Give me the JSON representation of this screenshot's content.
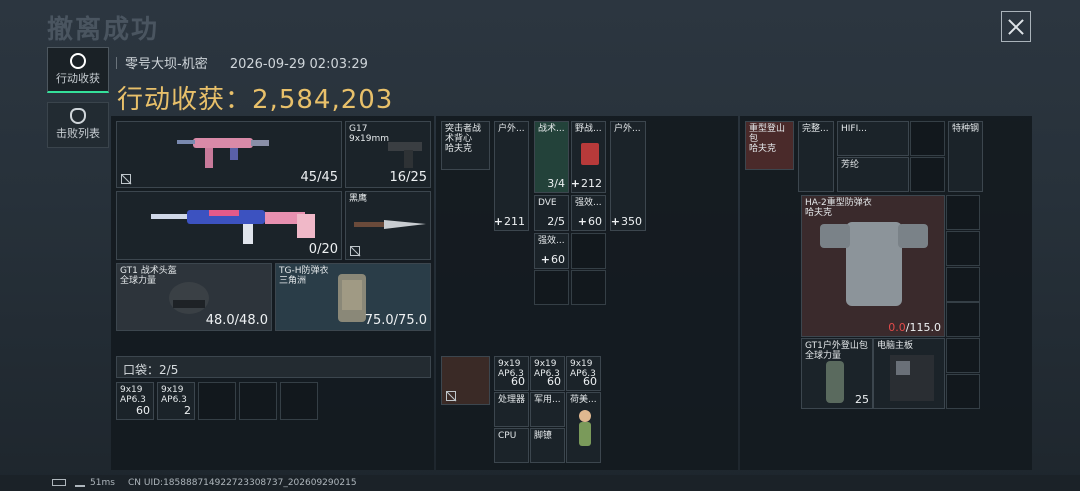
{
  "header": {
    "title": "撤离成功",
    "map_name": "零号大坝-机密",
    "datetime": "2026-09-29 02:03:29"
  },
  "tabs": [
    {
      "label": "行动收获",
      "active": true
    },
    {
      "label": "击败列表",
      "active": false
    }
  ],
  "harvest": {
    "label": "行动收获：",
    "value": "2,584,203"
  },
  "weapons": {
    "primary1": {
      "value": "45/45"
    },
    "sidearm": {
      "name": "G17",
      "caliber": "9x19mm",
      "value": "16/25"
    },
    "primary2": {
      "value": "0/20"
    },
    "melee": {
      "name": "黑鹰"
    },
    "helmet": {
      "name": "GT1 战术头盔",
      "brand": "全球力量",
      "value": "48.0/48.0"
    },
    "armor": {
      "name": "TG-H防弹衣",
      "brand": "三角洲",
      "value": "75.0/75.0"
    }
  },
  "pocket": {
    "label": "口袋：",
    "count": "2",
    "total": "5",
    "items": [
      {
        "name": "9x19",
        "sub": "AP6.3",
        "qty": "60"
      },
      {
        "name": "9x19",
        "sub": "AP6.3",
        "qty": "2"
      }
    ]
  },
  "middle": {
    "vest": {
      "name": "突击者战术背心",
      "brand": "哈夫克"
    },
    "items": [
      {
        "name": "户外...",
        "qty": "211"
      },
      {
        "name": "战术...",
        "qty": "3/4"
      },
      {
        "name": "野战...",
        "qty": "212"
      },
      {
        "name": "户外...",
        "qty": "350"
      },
      {
        "name": "DVE",
        "qty": "2/5"
      },
      {
        "name": "强效...",
        "qty": "60"
      },
      {
        "name": "强效...",
        "qty": "60"
      }
    ],
    "case_items": [
      {
        "name": "9x19",
        "sub": "AP6.3",
        "qty": "60"
      },
      {
        "name": "9x19",
        "sub": "AP6.3",
        "qty": "60"
      },
      {
        "name": "9x19",
        "sub": "AP6.3",
        "qty": "60"
      },
      {
        "name": "处理器"
      },
      {
        "name": "军用..."
      },
      {
        "name": "荷美..."
      },
      {
        "name": "CPU"
      },
      {
        "name": "脚镣"
      }
    ]
  },
  "right": {
    "backpack_top": [
      {
        "name": "重型登山包",
        "brand": "哈夫克"
      },
      {
        "name": "完整..."
      },
      {
        "name": "HIFI..."
      },
      {
        "name": "特种钢"
      },
      {
        "name": "芳纶"
      }
    ],
    "armor": {
      "name": "HA-2重型防弹衣",
      "brand": "哈夫克",
      "durability": "0.0",
      "max": "/115.0"
    },
    "backpack": {
      "name": "GT1户外登山包",
      "brand": "全球力量",
      "qty": "25"
    },
    "motherboard": {
      "name": "电脑主板"
    }
  },
  "status": {
    "ping": "51ms",
    "uid": "CN UID:185888714922723308737_202609290215"
  },
  "colors": {
    "accent_green": "#35e09a",
    "gold": "#e8c06a",
    "red_zero": "#e24a4a"
  },
  "icons": [
    "close-icon",
    "target-icon",
    "skull-icon",
    "no-lock-icon",
    "battery-icon",
    "signal-icon"
  ]
}
